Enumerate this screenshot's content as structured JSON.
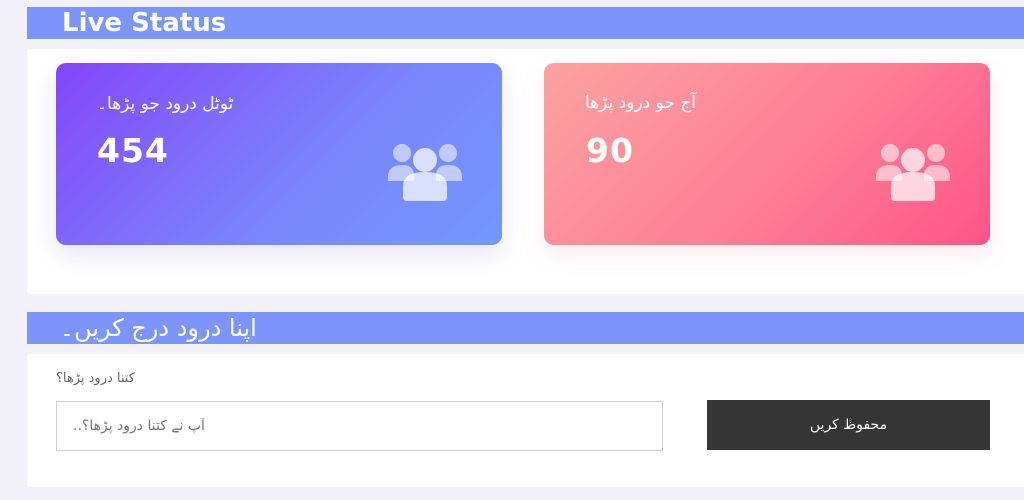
{
  "live_status": {
    "title": "Live Status",
    "cards": [
      {
        "label": "ٹوٹل درود جو پڑھا۔",
        "value": "454",
        "icon": "users-icon",
        "gradient": [
          "#8446f8",
          "#7397fc"
        ]
      },
      {
        "label": "آج جو درود پڑھا",
        "value": "90",
        "icon": "users-icon",
        "gradient": [
          "#fba3a1",
          "#fe5487"
        ]
      }
    ]
  },
  "entry": {
    "title": "اپنا درود درج کریں۔",
    "field_label": "کتنا درود پڑھا؟",
    "input_placeholder": "آپ نے کتنا درود پڑھا؟..",
    "input_value": "",
    "save_label": "محفوظ کریں"
  },
  "colors": {
    "header": "#7d95fb",
    "background": "#f3f2fa",
    "button": "#353535"
  }
}
